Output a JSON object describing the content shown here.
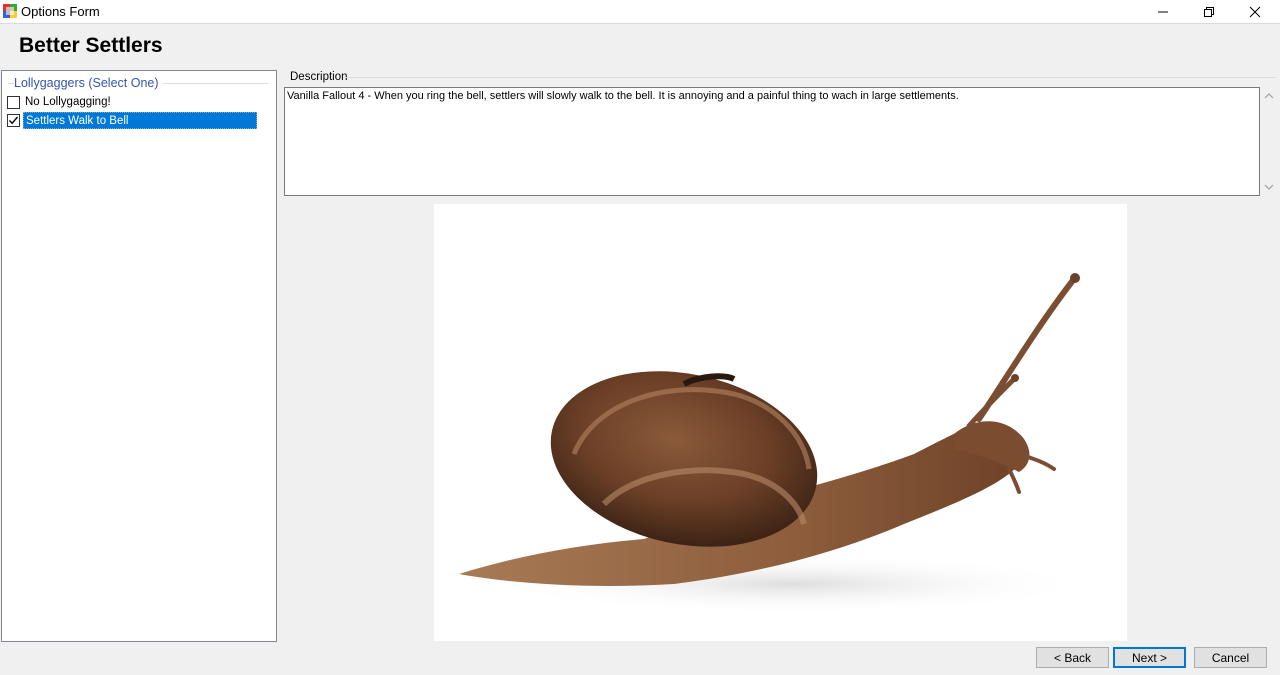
{
  "window": {
    "title": "Options Form",
    "icons": [
      "app-icon",
      "minimize-icon",
      "restore-icon",
      "close-icon"
    ]
  },
  "header": {
    "title": "Better Settlers"
  },
  "group": {
    "title": "Lollygaggers (Select One)",
    "options": [
      {
        "label": "No Lollygagging!",
        "checked": false
      },
      {
        "label": "Settlers Walk to Bell",
        "checked": true
      }
    ]
  },
  "description": {
    "label": "Description",
    "text": "Vanilla Fallout 4 - When you ring the bell, settlers will slowly walk to the bell.  It is annoying and a painful thing to wach in large settlements."
  },
  "buttons": {
    "back": "< Back",
    "next": "Next >",
    "cancel": "Cancel"
  },
  "colors": {
    "selection": "#0078d7",
    "group_title": "#3355aa"
  }
}
